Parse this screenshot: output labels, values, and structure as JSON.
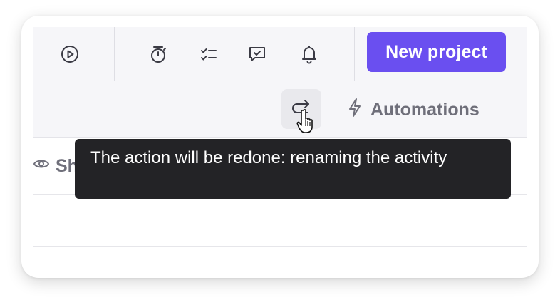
{
  "toolbar": {
    "icons": [
      "play-circle-icon",
      "timer-icon",
      "checklist-icon",
      "chat-icon",
      "bell-icon"
    ],
    "new_project_label": "New project"
  },
  "actions_bar": {
    "redo_icon": "redo-icon",
    "automations_icon": "lightning-icon",
    "automations_label": "Automations"
  },
  "filter_bar": {
    "show_icon": "eye-icon",
    "show_label": "Sh"
  },
  "tooltip": {
    "text": "The action will be redone: renaming the activity"
  },
  "colors": {
    "accent": "#6a4ff0",
    "tooltip_bg": "#232326",
    "toolbar_bg": "#f6f6f9",
    "muted_text": "#6f6f7a"
  }
}
